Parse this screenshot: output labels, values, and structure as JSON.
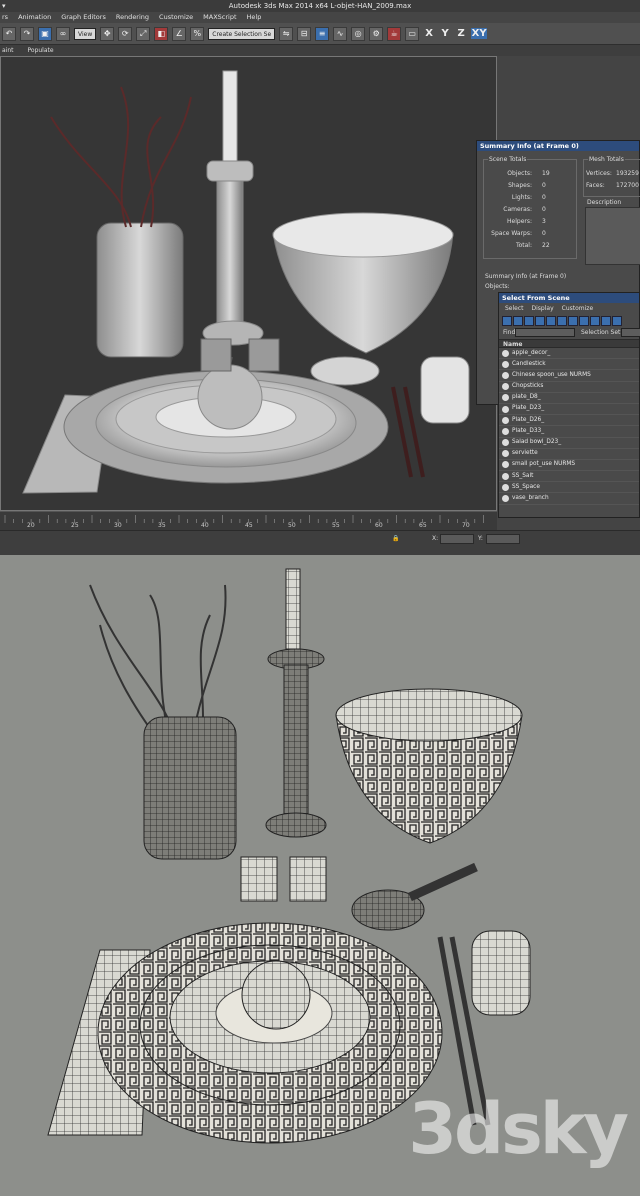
{
  "window": {
    "left_glyph": "▾",
    "title": "Autodesk 3ds Max  2014 x64    L-objet-HAN_2009.max"
  },
  "menu": [
    "rs",
    "Animation",
    "Graph Editors",
    "Rendering",
    "Customize",
    "MAXScript",
    "Help"
  ],
  "toolbar": {
    "view_dropdown": "View",
    "selection_set": "Create Selection Se",
    "axis_x": "X",
    "axis_y": "Y",
    "axis_z": "Z",
    "axis_xy": "XY"
  },
  "ribbon": [
    "aint",
    "Populate"
  ],
  "timeline": {
    "ticks": [
      "20",
      "25",
      "30",
      "35",
      "40",
      "45",
      "50",
      "55",
      "60",
      "65",
      "70"
    ]
  },
  "status": {
    "x_label": "X:",
    "y_label": "Y:"
  },
  "summary": {
    "title": "Summary Info (at Frame 0)",
    "scene_totals_label": "Scene Totals",
    "rows": [
      {
        "label": "Objects:",
        "value": "19"
      },
      {
        "label": "Shapes:",
        "value": "0"
      },
      {
        "label": "Lights:",
        "value": "0"
      },
      {
        "label": "Cameras:",
        "value": "0"
      },
      {
        "label": "Helpers:",
        "value": "3"
      },
      {
        "label": "Space Warps:",
        "value": "0"
      },
      {
        "label": "Total:",
        "value": "22"
      }
    ],
    "mesh_totals_label": "Mesh Totals",
    "vertices_label": "Vertices:",
    "vertices_value": "193259",
    "faces_label": "Faces:",
    "faces_value": "172700",
    "description_label": "Description",
    "footer_title": "Summary Info (at Frame 0)",
    "objects_label": "Objects:"
  },
  "select_from_scene": {
    "title": "Select From Scene",
    "menu": [
      "Select",
      "Display",
      "Customize"
    ],
    "find_label": "Find:",
    "selection_set_label": "Selection Set:",
    "column_name": "Name",
    "items": [
      "apple_decor_",
      "Candlestick",
      "Chinese spoon_use NURMS",
      "Chopsticks",
      "plate_D8_",
      "Plate_D23_",
      "Plate_D26_",
      "Plate_D33_",
      "Salad bowl_D23_",
      "serviette",
      "small pot_use NURMS",
      "SS_Salt",
      "SS_Space",
      "vase_branch"
    ]
  },
  "watermark": "3dsky"
}
